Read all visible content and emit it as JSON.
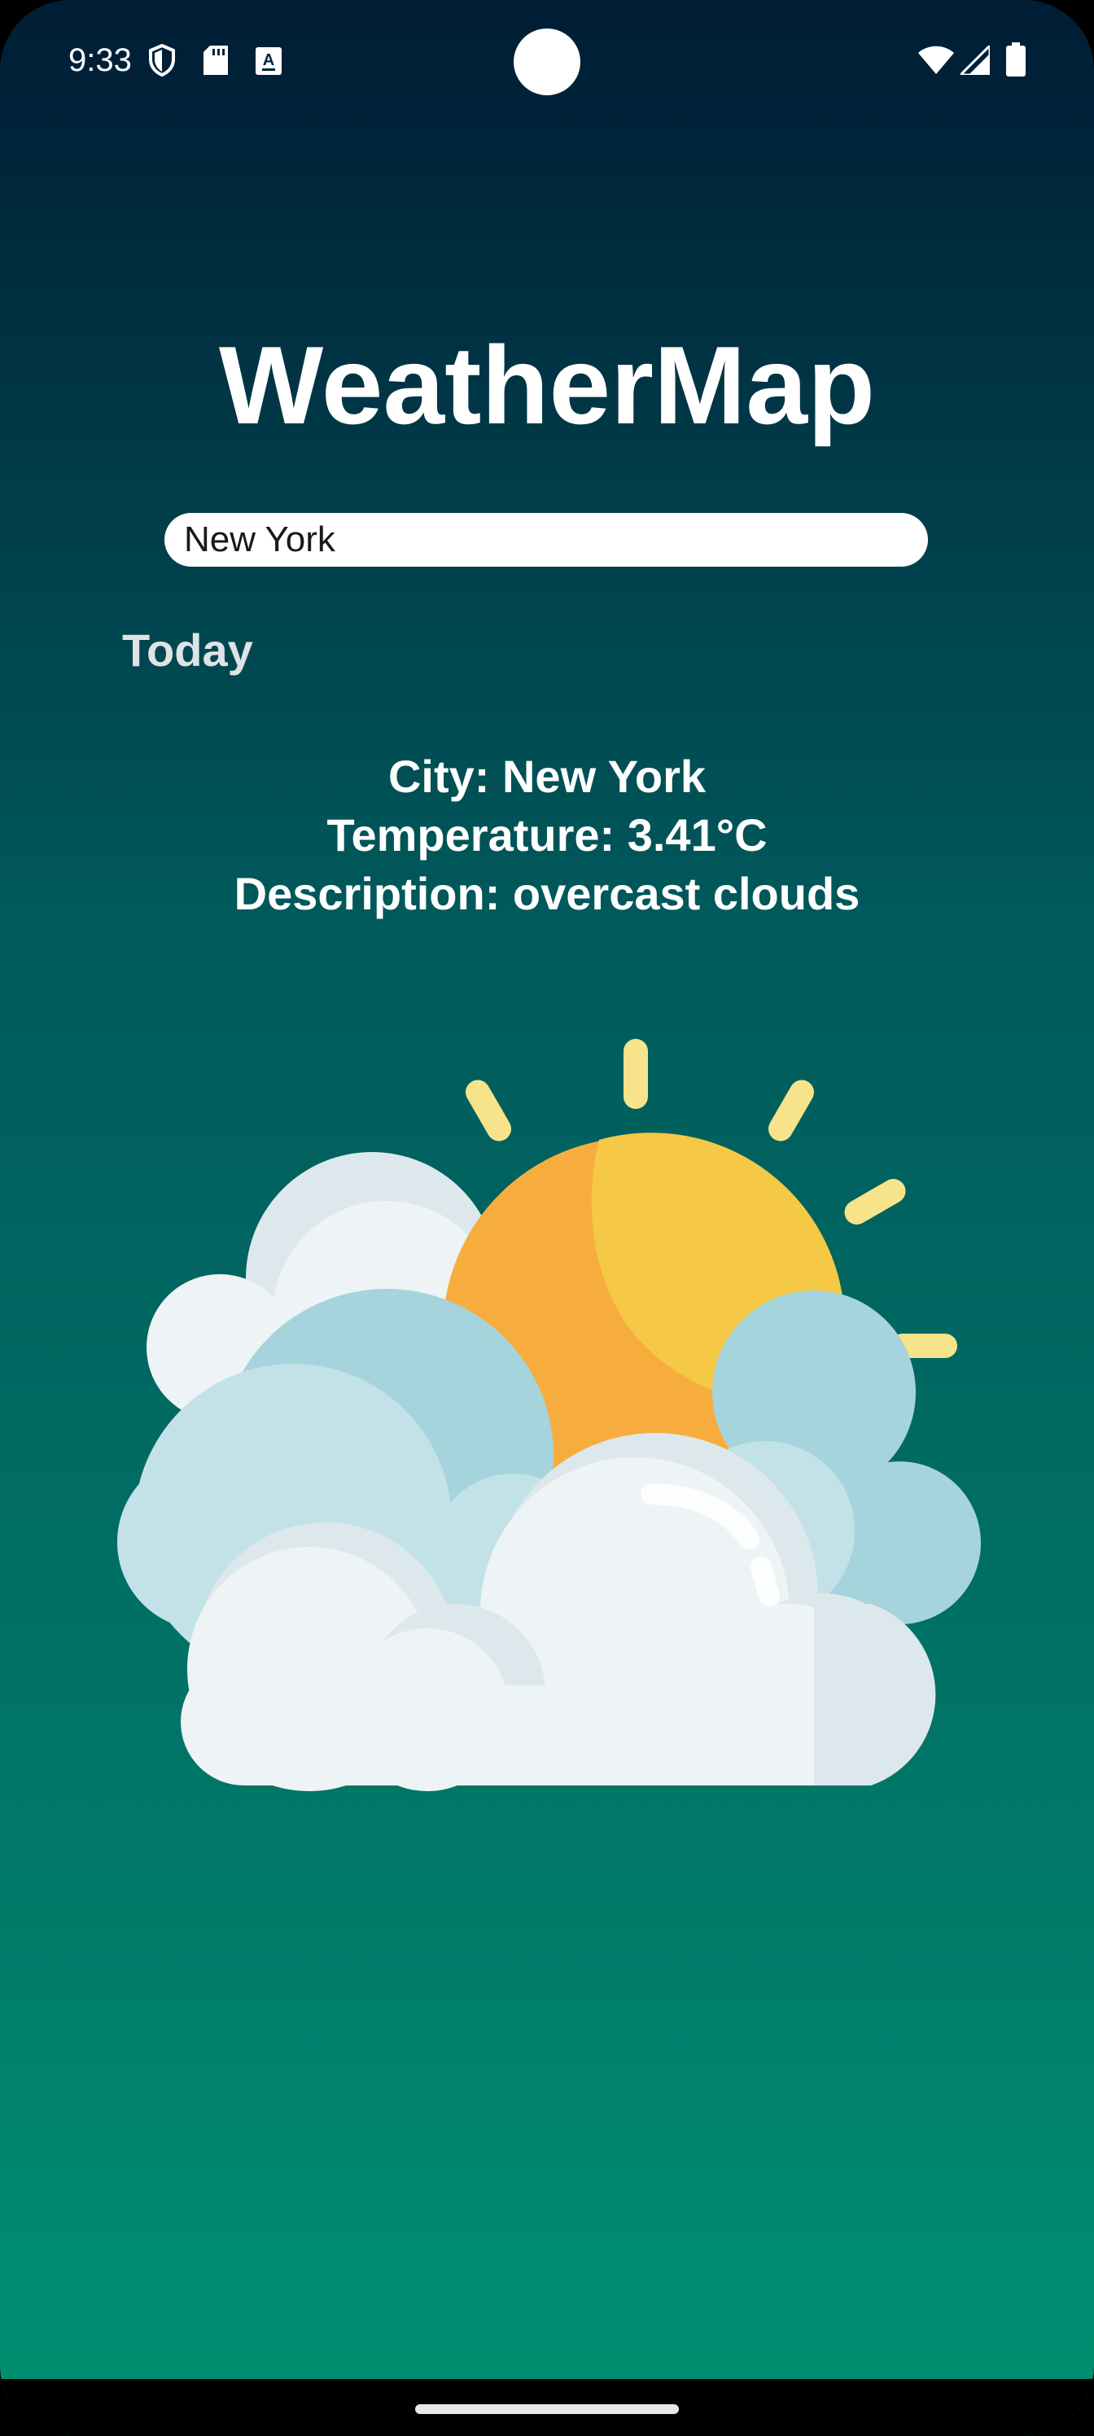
{
  "status_bar": {
    "time": "9:33",
    "left_icons": [
      "shield-icon",
      "sd-card-icon",
      "keyboard-a-icon"
    ],
    "right_icons": [
      "wifi-icon",
      "cell-signal-icon",
      "battery-icon"
    ]
  },
  "app": {
    "title": "WeatherMap"
  },
  "search": {
    "value": "New York"
  },
  "section": {
    "today_label": "Today"
  },
  "weather": {
    "city_line": "City: New York",
    "temperature_line": "Temperature: 3.41°C",
    "description_line": "Description: overcast clouds",
    "icon": "partly-cloudy-sun-icon"
  },
  "colors": {
    "background_top": "#001e35",
    "background_bottom": "#00906f",
    "sun_orange": "#f7ad3e",
    "sun_yellow": "#f5c845",
    "ray_yellow": "#f7e48a",
    "cloud_light": "#eef3f6",
    "cloud_blue": "#a6d4dc"
  }
}
